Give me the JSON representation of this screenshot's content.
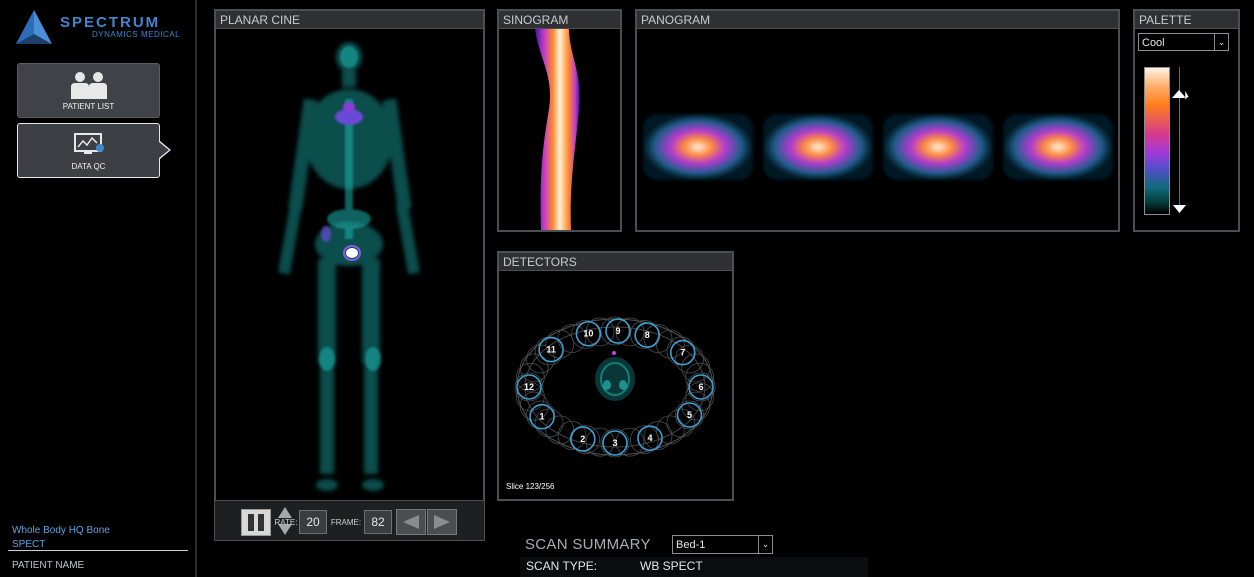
{
  "brand": {
    "name": "SPECTRUM",
    "subtitle": "DYNAMICS MEDICAL"
  },
  "sidebar": {
    "items": [
      {
        "label": "PATIENT LIST",
        "icon": "patients-icon",
        "active": false
      },
      {
        "label": "DATA QC",
        "icon": "chart-monitor-icon",
        "active": true
      }
    ],
    "study_name": "Whole Body HQ Bone",
    "study_type": "SPECT",
    "patient_name_label": "PATIENT NAME"
  },
  "panels": {
    "planar_cine": "PLANAR CINE",
    "sinogram": "SINOGRAM",
    "panogram": "PANOGRAM",
    "palette": "PALETTE",
    "detectors": "DETECTORS"
  },
  "cine": {
    "rate_label": "RATE:",
    "rate_value": "20",
    "frame_label": "FRAME:",
    "frame_value": "82"
  },
  "palette": {
    "selected": "Cool",
    "colors": [
      "#fff3e6",
      "#ff7f1e",
      "#d83a8a",
      "#a23ad8",
      "#0f6a7a",
      "#000000"
    ]
  },
  "detectors": {
    "labels": [
      "1",
      "2",
      "3",
      "4",
      "5",
      "6",
      "7",
      "8",
      "9",
      "10",
      "11",
      "12"
    ],
    "slice_text": "Slice 123/256"
  },
  "summary": {
    "title": "SCAN SUMMARY",
    "bed_selected": "Bed-1",
    "scan_type_label": "SCAN TYPE:",
    "scan_type_value": "WB SPECT"
  },
  "colors": {
    "accent": "#3f86cf",
    "panel_border": "#4b4e52",
    "study_text": "#5aa6e0"
  }
}
